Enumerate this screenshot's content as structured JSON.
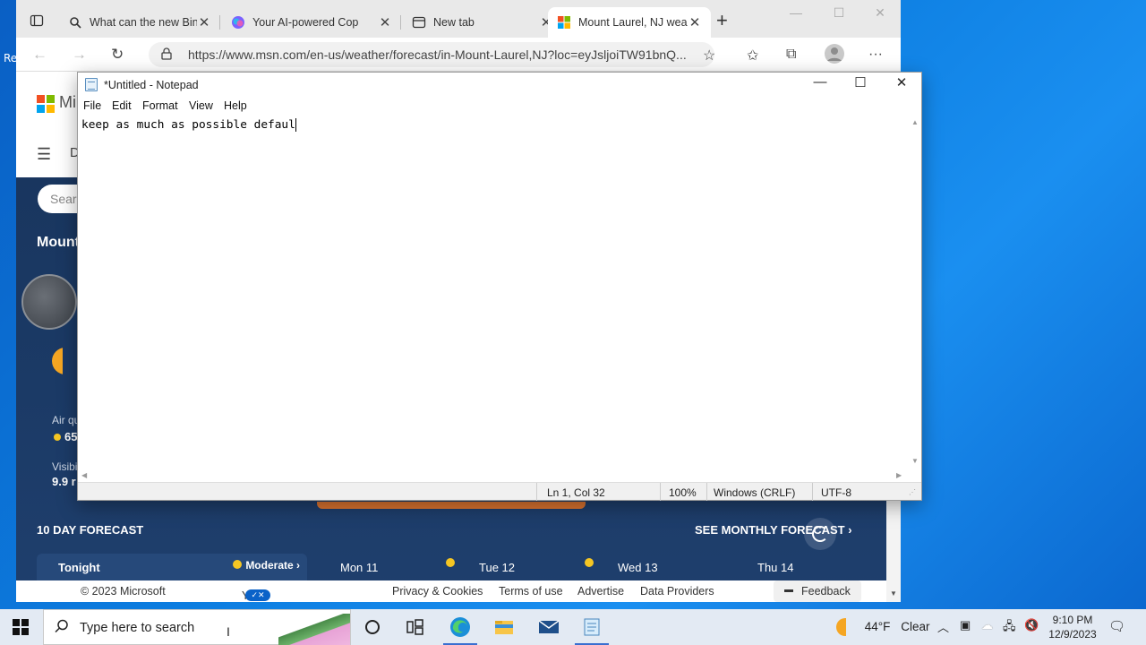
{
  "browser": {
    "tabs": [
      {
        "title": "What can the new Bing"
      },
      {
        "title": "Your AI-powered Cop"
      },
      {
        "title": "New tab"
      },
      {
        "title": "Mount Laurel, NJ wea"
      }
    ],
    "url": "https://www.msn.com/en-us/weather/forecast/in-Mount-Laurel,NJ?loc=eyJsljoiTW91bnQ..."
  },
  "msn": {
    "brand_partial": "Mi",
    "nav_partial": "D",
    "search_placeholder": "Sear",
    "location_partial": "Mount",
    "air_quality_label": "Air qu",
    "air_quality_value": "65",
    "visibility_label": "Visibi",
    "visibility_value": "9.9 r",
    "forecast_title": "10 DAY FORECAST",
    "monthly_link": "SEE MONTHLY FORECAST",
    "forecast_days": [
      {
        "label": "Tonight",
        "badge": "Moderate"
      },
      {
        "label": "Mon 11"
      },
      {
        "label": "Tue 12"
      },
      {
        "label": "Wed 13"
      },
      {
        "label": "Thu 14"
      }
    ],
    "footer": {
      "copyright": "© 2023 Microsoft",
      "privacy_choices": "Your Privacy Choices",
      "links": [
        "Privacy & Cookies",
        "Terms of use",
        "Advertise",
        "Data Providers"
      ],
      "feedback": "Feedback"
    }
  },
  "notepad": {
    "title": "*Untitled - Notepad",
    "menu": [
      "File",
      "Edit",
      "Format",
      "View",
      "Help"
    ],
    "content": "keep as much as possible defaul",
    "status": {
      "position": "Ln 1, Col 32",
      "zoom": "100%",
      "line_ending": "Windows (CRLF)",
      "encoding": "UTF-8"
    }
  },
  "taskbar": {
    "search_placeholder": "Type here to search",
    "weather_temp": "44°F",
    "weather_cond": "Clear",
    "time": "9:10 PM",
    "date": "12/9/2023"
  },
  "desktop": {
    "edge_text": "Re"
  },
  "colors": {
    "accent": "#0a62c8",
    "weather_bg": "#1b3a66",
    "orange": "#d9722f"
  }
}
